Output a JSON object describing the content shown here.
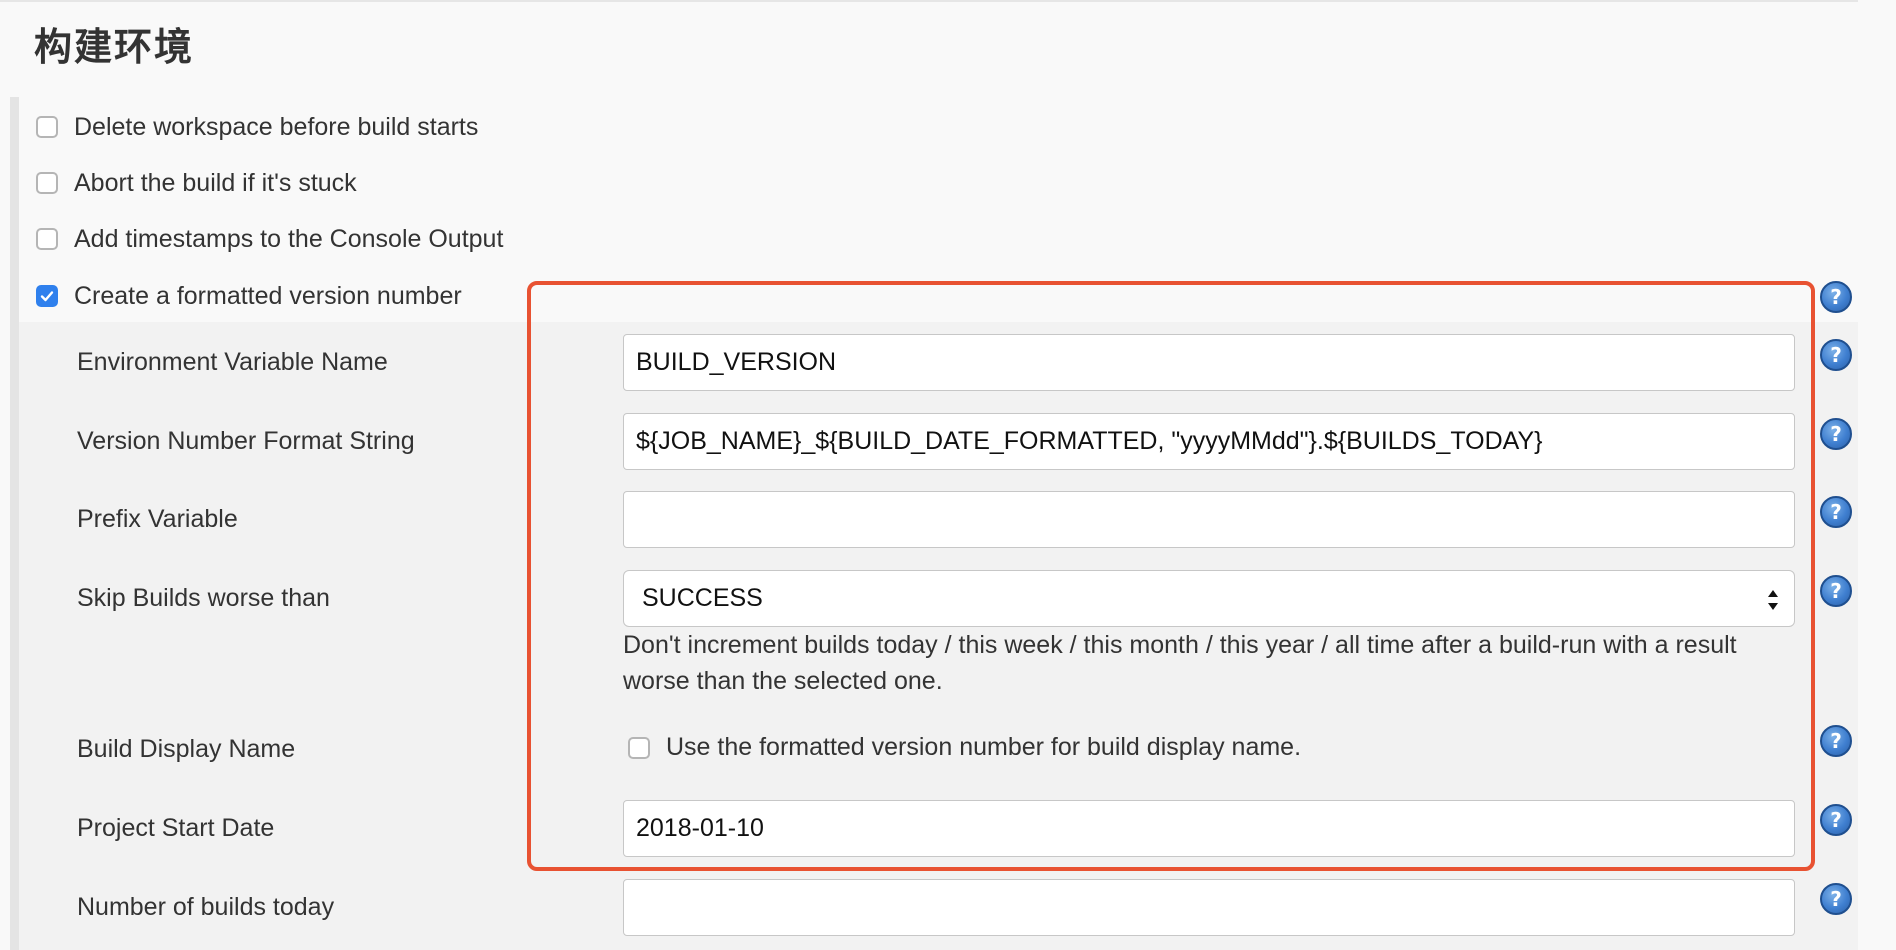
{
  "page": {
    "title": "构建环境"
  },
  "checkboxes": [
    {
      "label": "Delete workspace before build starts",
      "checked": false
    },
    {
      "label": "Abort the build if it's stuck",
      "checked": false
    },
    {
      "label": "Add timestamps to the Console Output",
      "checked": false
    },
    {
      "label": "Create a formatted version number",
      "checked": true
    }
  ],
  "fields": {
    "env_var": {
      "label": "Environment Variable Name",
      "value": "BUILD_VERSION"
    },
    "format_string": {
      "label": "Version Number Format String",
      "value": "${JOB_NAME}_${BUILD_DATE_FORMATTED, \"yyyyMMdd\"}.${BUILDS_TODAY}"
    },
    "prefix": {
      "label": "Prefix Variable",
      "value": ""
    },
    "skip_builds": {
      "label": "Skip Builds worse than",
      "value": "SUCCESS",
      "description": "Don't increment builds today / this week / this month / this year / all time after a build-run with a result worse than the selected one."
    },
    "display_name": {
      "label": "Build Display Name",
      "checkbox_label": "Use the formatted version number for build display name.",
      "checked": false
    },
    "start_date": {
      "label": "Project Start Date",
      "value": "2018-01-10"
    },
    "builds_today": {
      "label": "Number of builds today",
      "value": ""
    }
  },
  "help_icon": {
    "glyph": "?"
  },
  "colors": {
    "highlight": "#e85232",
    "checkbox_checked": "#2f80ed"
  }
}
